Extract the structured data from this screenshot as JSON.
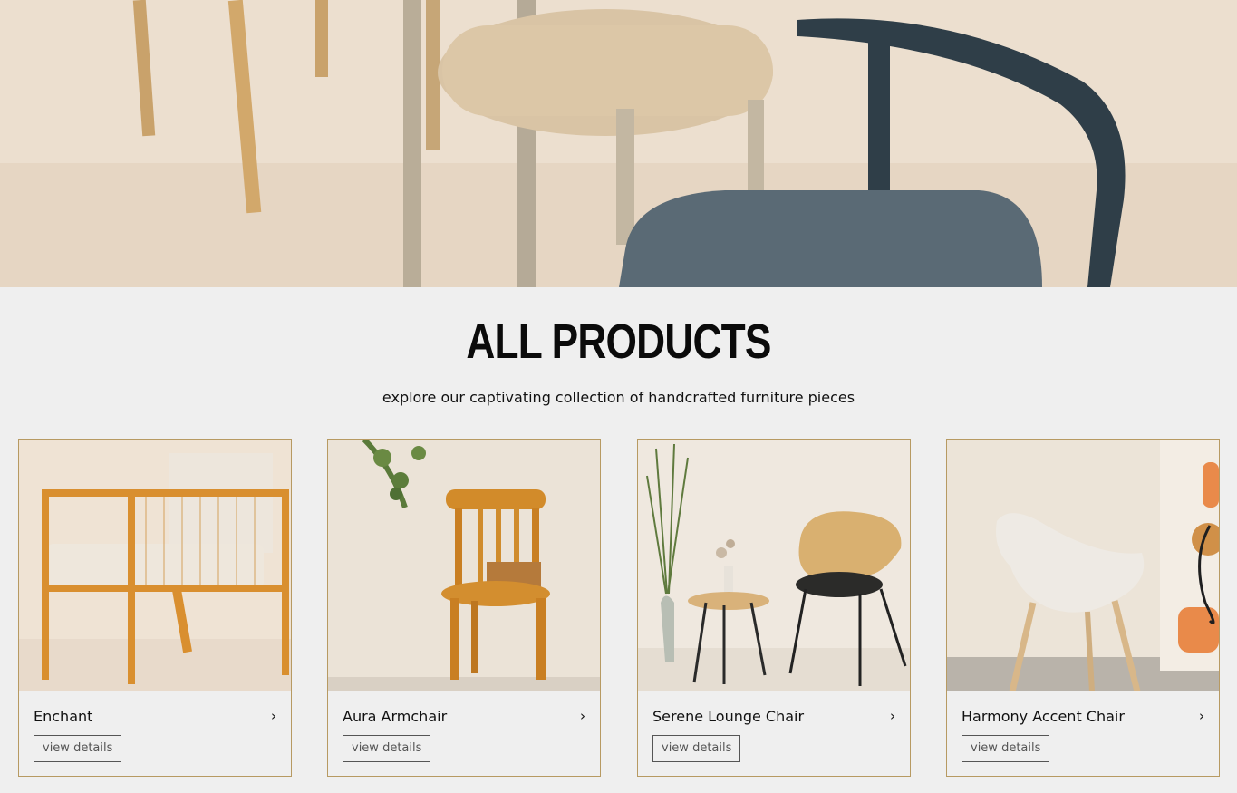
{
  "section": {
    "title": "ALL PRODUCTS",
    "subtitle": "explore our captivating collection of handcrafted furniture pieces"
  },
  "products": [
    {
      "name": "Enchant",
      "cta": "view details",
      "chevron": "›"
    },
    {
      "name": "Aura Armchair",
      "cta": "view details",
      "chevron": "›"
    },
    {
      "name": "Serene Lounge Chair",
      "cta": "view details",
      "chevron": "›"
    },
    {
      "name": "Harmony Accent Chair",
      "cta": "view details",
      "chevron": "›"
    }
  ],
  "colors": {
    "background": "#efefef",
    "card_border": "#b79a62",
    "text": "#111111"
  }
}
